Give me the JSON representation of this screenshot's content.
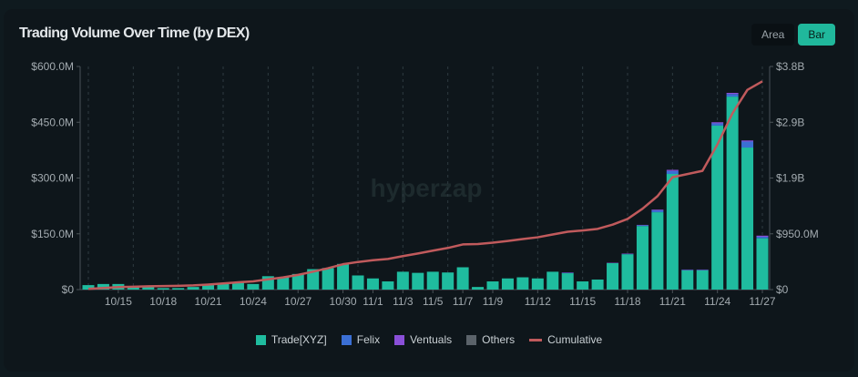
{
  "header": {
    "title": "Trading Volume Over Time (by DEX)",
    "toggle": [
      "Area",
      "Bar"
    ],
    "active": "Bar"
  },
  "watermark": "hyperzap",
  "colors": {
    "trade": "#1fbc9f",
    "felix": "#3b6fd4",
    "ventuals": "#8a4fd8",
    "others": "#5b636a",
    "cumulative": "#c05a5c"
  },
  "chart_data": {
    "type": "bar",
    "title": "Trading Volume Over Time (by DEX)",
    "stacked": true,
    "categories": [
      "10/13",
      "10/14",
      "10/15",
      "10/16",
      "10/17",
      "10/18",
      "10/19",
      "10/20",
      "10/21",
      "10/22",
      "10/23",
      "10/24",
      "10/25",
      "10/26",
      "10/27",
      "10/28",
      "10/29",
      "10/30",
      "10/31",
      "11/1",
      "11/2",
      "11/3",
      "11/4",
      "11/5",
      "11/6",
      "11/7",
      "11/8",
      "11/9",
      "11/10",
      "11/11",
      "11/12",
      "11/13",
      "11/14",
      "11/15",
      "11/16",
      "11/17",
      "11/18",
      "11/19",
      "11/20",
      "11/21",
      "11/22",
      "11/23",
      "11/24",
      "11/25",
      "11/26",
      "11/27"
    ],
    "series": [
      {
        "name": "Trade[XYZ]",
        "values": [
          12,
          15,
          15,
          7,
          7,
          4,
          4,
          7,
          15,
          18,
          20,
          15,
          36,
          33,
          42,
          55,
          58,
          69,
          38,
          30,
          22,
          48,
          45,
          48,
          46,
          60,
          7,
          22,
          30,
          33,
          30,
          48,
          44,
          22,
          27,
          71,
          95,
          171,
          208,
          311,
          52,
          52,
          441,
          519,
          382,
          138
        ]
      },
      {
        "name": "Felix",
        "values": [
          0,
          0,
          0,
          0,
          0,
          0,
          0,
          0,
          0,
          0,
          0,
          0,
          0,
          0,
          0,
          0,
          0,
          0,
          0,
          0,
          0,
          0,
          0,
          0,
          0,
          0,
          0,
          0,
          0,
          0,
          0,
          0,
          1,
          0,
          0,
          0,
          1,
          2,
          5,
          8,
          1,
          1,
          6,
          7,
          16,
          4
        ]
      },
      {
        "name": "Ventuals",
        "values": [
          0,
          0,
          0,
          0,
          0,
          0,
          0,
          0,
          0,
          0,
          0,
          0,
          0,
          0,
          0,
          0,
          0,
          0,
          0,
          0,
          0,
          0,
          0,
          0,
          0,
          0,
          0,
          0,
          0,
          0,
          0,
          0,
          1,
          0,
          0,
          1,
          1,
          1,
          2,
          3,
          1,
          1,
          3,
          3,
          3,
          3
        ]
      },
      {
        "name": "Others",
        "values": [
          0,
          0,
          0,
          0,
          0,
          0,
          0,
          0,
          0,
          0,
          0,
          0,
          0,
          0,
          0,
          0,
          0,
          0,
          0,
          0,
          0,
          0,
          0,
          0,
          0,
          0,
          0,
          0,
          0,
          0,
          0,
          0,
          0,
          0,
          0,
          0,
          0,
          0,
          0,
          0,
          0,
          0,
          0,
          0,
          0,
          0
        ]
      }
    ],
    "line_series": {
      "name": "Cumulative",
      "axis": "right",
      "values": "running sum of all series"
    },
    "x_tick_labels": [
      "10/15",
      "10/18",
      "10/21",
      "10/24",
      "10/27",
      "10/30",
      "11/1",
      "11/3",
      "11/5",
      "11/7",
      "11/9",
      "11/12",
      "11/15",
      "11/18",
      "11/21",
      "11/24",
      "11/27"
    ],
    "y_left": {
      "unit": "M USD",
      "ylim": [
        0,
        600
      ],
      "ticks": [
        0,
        150,
        300,
        450,
        600
      ],
      "tick_labels": [
        "$0",
        "$150.0M",
        "$300.0M",
        "$450.0M",
        "$600.0M"
      ]
    },
    "y_right": {
      "unit": "M USD",
      "ylim": [
        0,
        3800
      ],
      "ticks": [
        0,
        950,
        1900,
        2850,
        3800
      ],
      "tick_labels": [
        "$0",
        "$950.0M",
        "$1.9B",
        "$2.9B",
        "$3.8B"
      ]
    },
    "legend": {
      "position": "bottom",
      "entries": [
        "Trade[XYZ]",
        "Felix",
        "Ventuals",
        "Others",
        "Cumulative"
      ]
    },
    "grid": "vertical dashed every 3 days"
  }
}
